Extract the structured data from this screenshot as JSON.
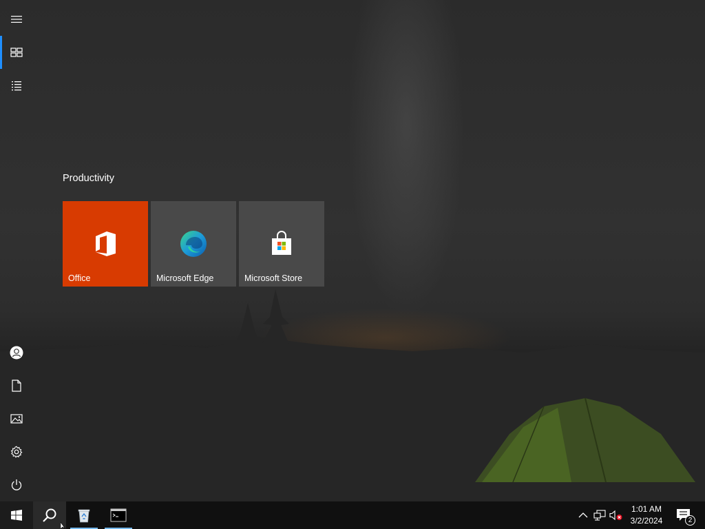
{
  "start_menu": {
    "rail": {
      "top": [
        {
          "name": "expand",
          "icon": "hamburger-menu-icon"
        },
        {
          "name": "pinned-tiles",
          "icon": "tiles-icon",
          "active": true
        },
        {
          "name": "all-apps",
          "icon": "app-list-icon"
        }
      ],
      "bottom": [
        {
          "name": "user",
          "icon": "user-icon"
        },
        {
          "name": "documents",
          "icon": "document-icon"
        },
        {
          "name": "pictures",
          "icon": "pictures-icon"
        },
        {
          "name": "settings",
          "icon": "gear-icon"
        },
        {
          "name": "power",
          "icon": "power-icon"
        }
      ]
    },
    "group": {
      "title": "Productivity",
      "tiles": [
        {
          "label": "Office",
          "icon": "office-icon",
          "color": "#d83b01"
        },
        {
          "label": "Microsoft Edge",
          "icon": "edge-icon",
          "color": "#4e4e4e"
        },
        {
          "label": "Microsoft Store",
          "icon": "store-icon",
          "color": "#4e4e4e"
        }
      ]
    }
  },
  "taskbar": {
    "start_icon": "windows-logo-icon",
    "search_icon": "search-icon",
    "pinned": [
      {
        "name": "recycle-bin",
        "icon": "recycle-bin-icon",
        "running": true
      },
      {
        "name": "command-prompt",
        "icon": "terminal-icon",
        "running": true
      }
    ],
    "tray": {
      "icons": [
        "chevron-up-icon",
        "network-icon",
        "volume-muted-icon"
      ],
      "time": "1:01 AM",
      "date": "3/2/2024",
      "notification_count": "2"
    }
  },
  "colors": {
    "accent": "#1f8fff",
    "office_tile": "#d83b01",
    "taskbar": "#101010",
    "running_indicator": "#76b9ed"
  }
}
